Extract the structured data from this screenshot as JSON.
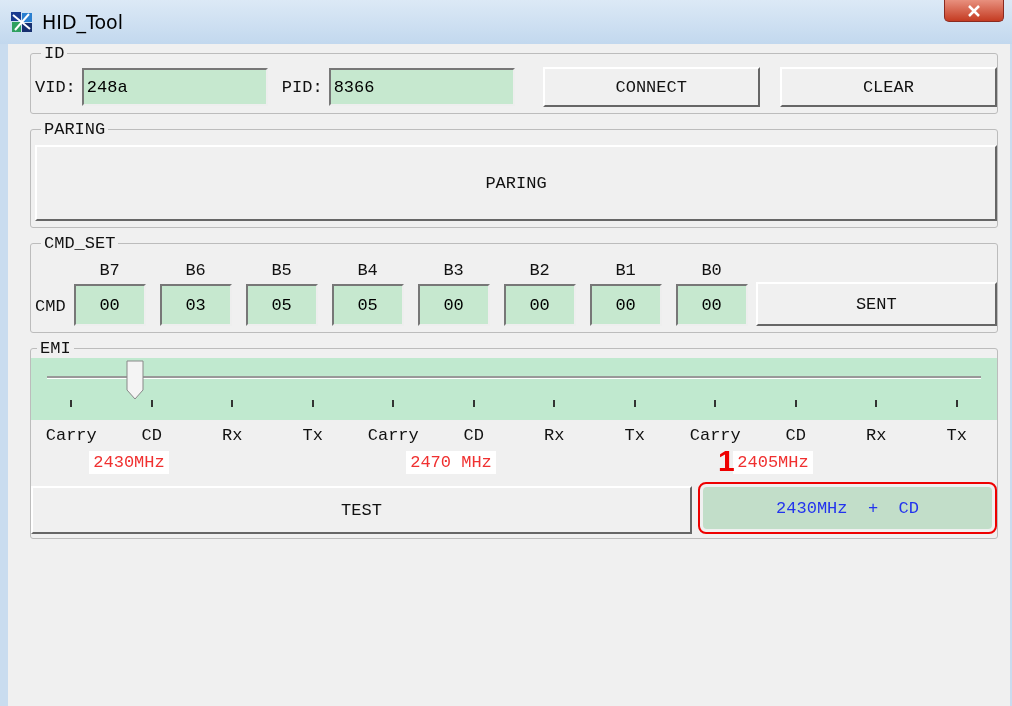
{
  "window": {
    "title": "HID_Tool"
  },
  "id_group": {
    "title": "ID",
    "vid_label": "VID:",
    "vid": "248a",
    "pid_label": "PID:",
    "pid": "8366",
    "buttons": [
      "CONNECT",
      "CLEAR"
    ]
  },
  "paring_group": {
    "title": "PARING",
    "button": "PARING"
  },
  "cmd_group": {
    "title": "CMD_SET",
    "row_label": "CMD",
    "bytes": [
      {
        "label": "B7",
        "value": "00"
      },
      {
        "label": "B6",
        "value": "03"
      },
      {
        "label": "B5",
        "value": "05"
      },
      {
        "label": "B4",
        "value": "05"
      },
      {
        "label": "B3",
        "value": "00"
      },
      {
        "label": "B2",
        "value": "00"
      },
      {
        "label": "B1",
        "value": "00"
      },
      {
        "label": "B0",
        "value": "00"
      }
    ],
    "button": "SENT"
  },
  "emi_group": {
    "title": "EMI",
    "slider": {
      "level": 0.0909
    },
    "groups": [
      {
        "ticks": [
          "Carry",
          "CD",
          "Rx",
          "Tx"
        ],
        "frequency": "2430MHz"
      },
      {
        "ticks": [
          "Carry",
          "CD",
          "Rx",
          "Tx"
        ],
        "frequency": "2470 MHz"
      },
      {
        "ticks": [
          "Carry",
          "CD",
          "Rx",
          "Tx"
        ],
        "frequency": "2405MHz"
      }
    ],
    "test_button": "TEST",
    "result": "2430MHz  +  CD"
  },
  "annotation": {
    "label": "1"
  }
}
